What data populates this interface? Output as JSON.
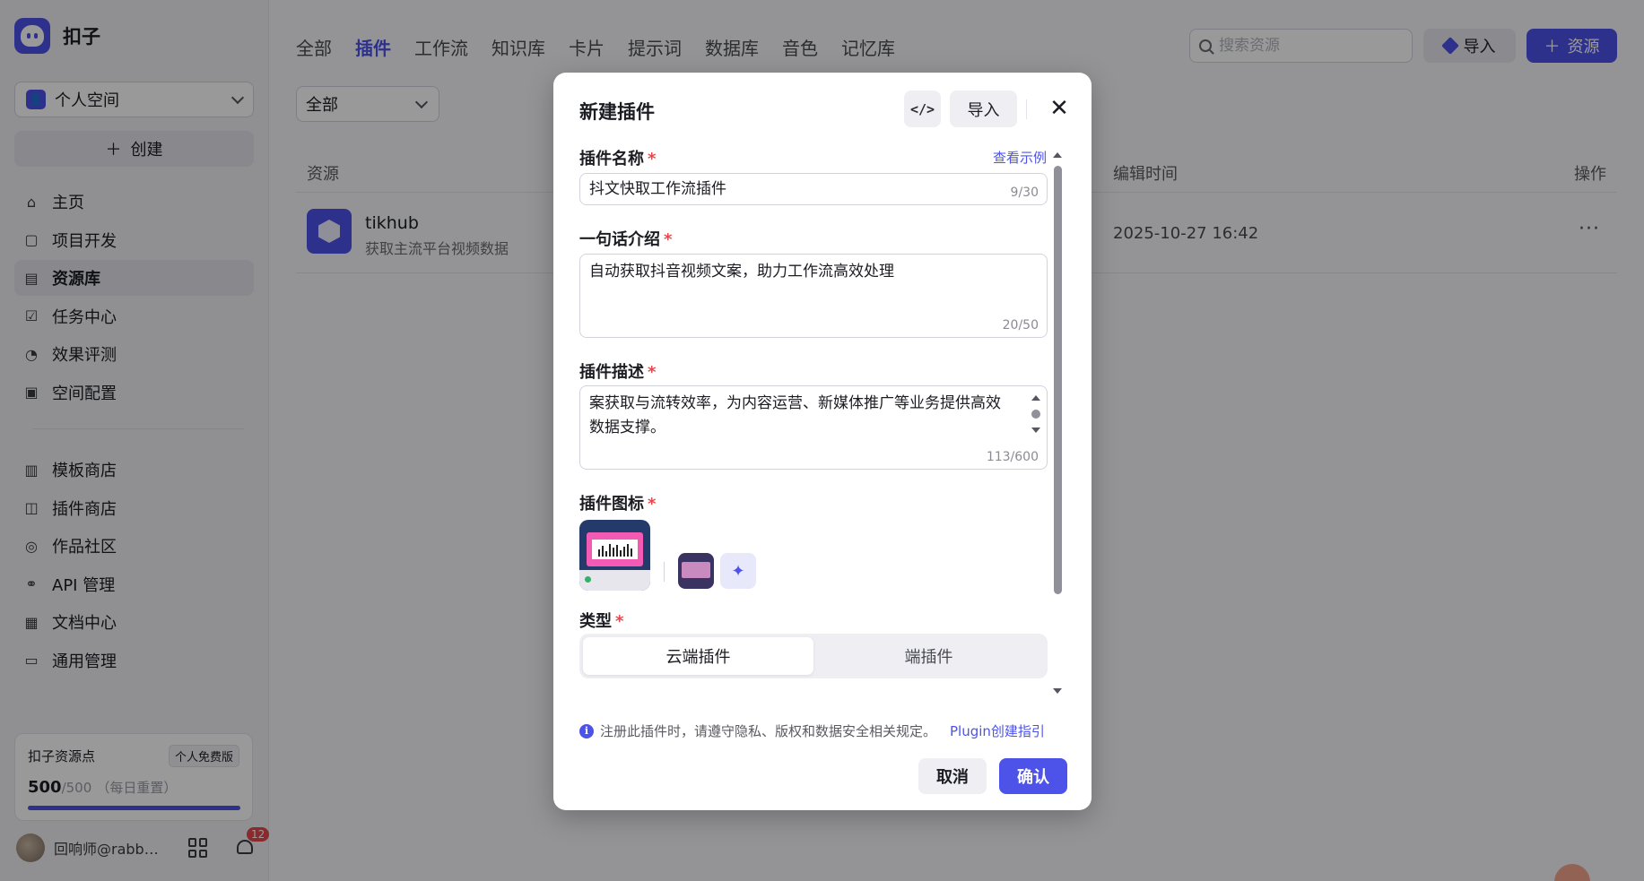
{
  "app": {
    "name": "扣子"
  },
  "sidebar": {
    "space_label": "个人空间",
    "create_label": "创建",
    "items": [
      {
        "label": "主页",
        "icon": "home-icon"
      },
      {
        "label": "项目开发",
        "icon": "project-icon"
      },
      {
        "label": "资源库",
        "icon": "library-icon",
        "active": true
      },
      {
        "label": "任务中心",
        "icon": "task-icon"
      },
      {
        "label": "效果评测",
        "icon": "evaluate-icon"
      },
      {
        "label": "空间配置",
        "icon": "config-icon"
      }
    ],
    "items2": [
      {
        "label": "模板商店",
        "icon": "template-icon"
      },
      {
        "label": "插件商店",
        "icon": "plugin-icon"
      },
      {
        "label": "作品社区",
        "icon": "community-icon"
      },
      {
        "label": "API 管理",
        "icon": "api-icon"
      },
      {
        "label": "文档中心",
        "icon": "doc-icon"
      },
      {
        "label": "通用管理",
        "icon": "manage-icon"
      }
    ],
    "points": {
      "title": "扣子资源点",
      "badge": "个人免费版",
      "value": "500",
      "total": "/500",
      "note": "（每日重置）",
      "fraction": 1.0
    },
    "user": {
      "name": "回响师@rabbit…",
      "notifications": "12"
    }
  },
  "header": {
    "tabs": [
      "全部",
      "插件",
      "工作流",
      "知识库",
      "卡片",
      "提示词",
      "数据库",
      "音色",
      "记忆库"
    ],
    "active_tab": 1,
    "search_placeholder": "搜索资源",
    "import_label": "导入",
    "resource_label": "资源"
  },
  "filter": {
    "value": "全部"
  },
  "table": {
    "headers": {
      "resource": "资源",
      "edit_time": "编辑时间",
      "action": "操作"
    },
    "rows": [
      {
        "name": "tikhub",
        "desc": "获取主流平台视频数据",
        "time": "2025-10-27 16:42",
        "more": "···"
      }
    ]
  },
  "modal": {
    "title": "新建插件",
    "code_label": "</>",
    "import_label": "导入",
    "close_label": "✕",
    "name_label": "插件名称",
    "example_link": "查看示例",
    "name_value": "抖文快取工作流插件",
    "name_count": "9/30",
    "intro_label": "一句话介绍",
    "intro_value": "自动获取抖音视频文案，助力工作流高效处理",
    "intro_count": "20/50",
    "desc_label": "插件描述",
    "desc_value": "案获取与流转效率，为内容运营、新媒体推广等业务提供高效数据支撑。",
    "desc_count": "113/600",
    "icon_label": "插件图标",
    "type_label": "类型",
    "type_options": [
      "云端插件",
      "端插件"
    ],
    "type_selected": 0,
    "notice": "注册此插件时，请遵守隐私、版权和数据安全相关规定。",
    "notice_link": "Plugin创建指引",
    "cancel_label": "取消",
    "confirm_label": "确认"
  },
  "colors": {
    "accent": "#4d53e8",
    "required": "#e5484d"
  }
}
